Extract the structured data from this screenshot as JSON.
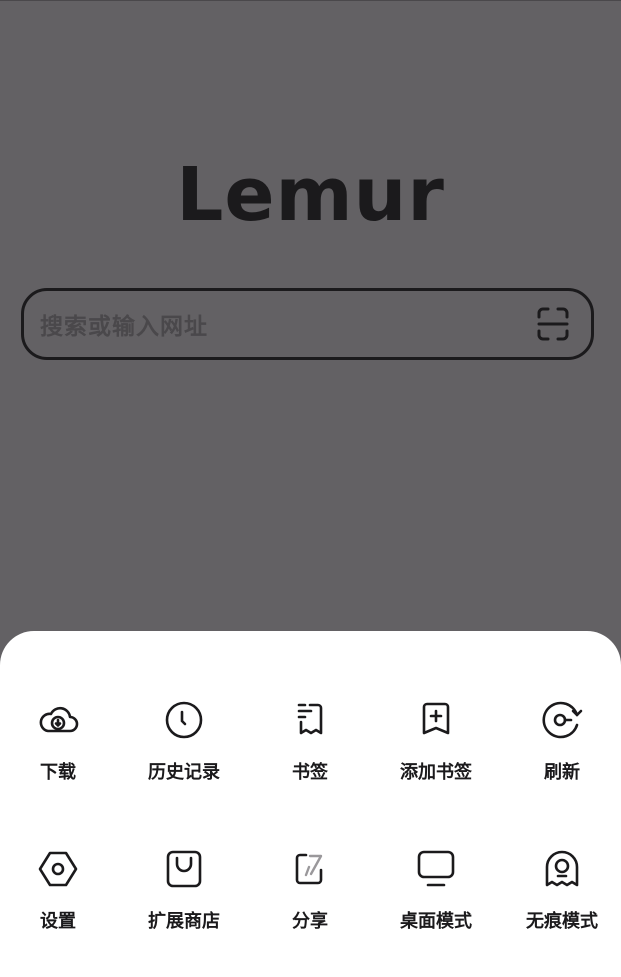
{
  "app": {
    "logo": "Lemur"
  },
  "search": {
    "placeholder": "搜索或输入网址",
    "scan_icon": "scan-icon"
  },
  "menu": {
    "items": [
      {
        "label": "下载",
        "icon": "cloud-download-icon"
      },
      {
        "label": "历史记录",
        "icon": "clock-icon"
      },
      {
        "label": "书签",
        "icon": "bookmark-list-icon"
      },
      {
        "label": "添加书签",
        "icon": "add-bookmark-icon"
      },
      {
        "label": "刷新",
        "icon": "refresh-icon"
      },
      {
        "label": "设置",
        "icon": "hexagon-settings-icon"
      },
      {
        "label": "扩展商店",
        "icon": "shopping-bag-icon"
      },
      {
        "label": "分享",
        "icon": "share-icon"
      },
      {
        "label": "桌面模式",
        "icon": "monitor-icon"
      },
      {
        "label": "无痕模式",
        "icon": "incognito-ghost-icon"
      }
    ]
  },
  "colors": {
    "backdrop": "#636164",
    "sheet": "#ffffff",
    "ink": "#1b1a1c"
  }
}
